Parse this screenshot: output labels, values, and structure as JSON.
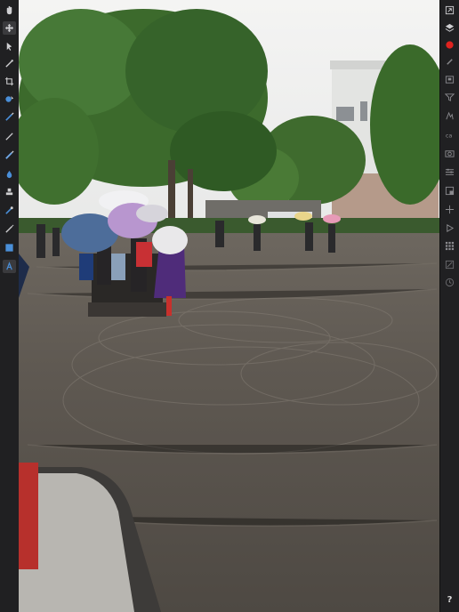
{
  "app": {
    "left_tools": [
      {
        "name": "hand-tool-icon"
      },
      {
        "name": "move-tool-icon"
      },
      {
        "name": "paint-brush-tool-icon"
      },
      {
        "name": "crop-tool-icon"
      },
      {
        "name": "color-picker-tool-icon"
      },
      {
        "name": "selection-brush-tool-icon"
      },
      {
        "name": "brush-tool-icon"
      },
      {
        "name": "pencil-tool-icon"
      },
      {
        "name": "fill-tool-icon"
      },
      {
        "name": "clone-tool-icon"
      },
      {
        "name": "smudge-tool-icon"
      },
      {
        "name": "eyedropper-tool-icon"
      },
      {
        "name": "shape-tool-icon"
      },
      {
        "name": "text-tool-icon"
      }
    ],
    "right_tools": [
      {
        "name": "export-icon"
      },
      {
        "name": "layers-icon"
      },
      {
        "name": "color-swatch-icon",
        "color": "#e0231f"
      },
      {
        "name": "brushes-icon"
      },
      {
        "name": "navigator-icon"
      },
      {
        "name": "filter-icon"
      },
      {
        "name": "adjustments-icon"
      },
      {
        "name": "channels-icon"
      },
      {
        "name": "camera-icon"
      },
      {
        "name": "sliders-icon"
      },
      {
        "name": "transform-icon"
      },
      {
        "name": "snapping-icon"
      },
      {
        "name": "play-macro-icon"
      },
      {
        "name": "grid-icon"
      },
      {
        "name": "history-icon"
      },
      {
        "name": "clock-icon"
      }
    ],
    "help_label": "?"
  },
  "colors": {
    "toolbar_bg": "#202022",
    "icon": "#cfcfd2",
    "accent_red": "#e0231f",
    "active_tool": "#3a3a3d"
  }
}
